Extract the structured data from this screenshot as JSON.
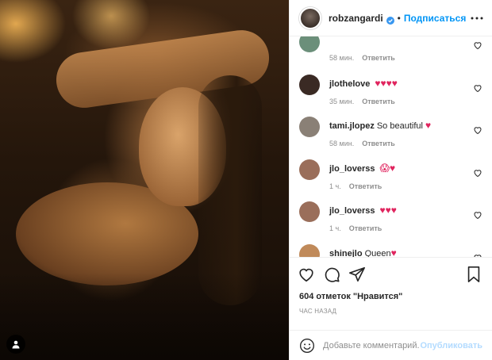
{
  "header": {
    "username": "robzangardi",
    "separator": "•",
    "follow_label": "Подписаться"
  },
  "comments": [
    {
      "username": "",
      "text": "",
      "emoji": "",
      "time": "58 мин.",
      "reply": "Ответить",
      "avatar_color": "#6b8f7a"
    },
    {
      "username": "jlothelove",
      "text": "",
      "emoji": "♥♥♥♥",
      "time": "35 мин.",
      "reply": "Ответить",
      "avatar_color": "#3a2a24"
    },
    {
      "username": "tami.jlopez",
      "text": "So beautiful",
      "emoji": "♥",
      "time": "58 мин.",
      "reply": "Ответить",
      "avatar_color": "#8a8076"
    },
    {
      "username": "jlo_loverss",
      "text": "",
      "emoji": "😱♥",
      "time": "1 ч.",
      "reply": "Ответить",
      "avatar_color": "#9a6e5a"
    },
    {
      "username": "jlo_loverss",
      "text": "",
      "emoji": "♥♥♥",
      "time": "1 ч.",
      "reply": "Ответить",
      "avatar_color": "#9a6e5a"
    },
    {
      "username": "shinejlo",
      "text": "Queen",
      "emoji": "♥",
      "time": "",
      "reply": "",
      "avatar_color": "#c08a5a"
    }
  ],
  "likes": {
    "count_text": "604 отметок \"Нравится\""
  },
  "time_ago": "час назад",
  "add_comment": {
    "placeholder": "Добавьте комментарий...",
    "publish_label": "Опубликовать"
  },
  "colors": {
    "accent": "#0095f6",
    "heart": "#e0245e",
    "muted": "#8e8e8e",
    "text": "#262626"
  },
  "icons": {
    "verified": "verified-badge-icon",
    "more": "more-options-icon",
    "like": "heart-icon",
    "comment": "comment-icon",
    "share": "share-icon",
    "save": "bookmark-icon",
    "emoji": "emoji-icon",
    "tag": "user-tag-icon"
  }
}
